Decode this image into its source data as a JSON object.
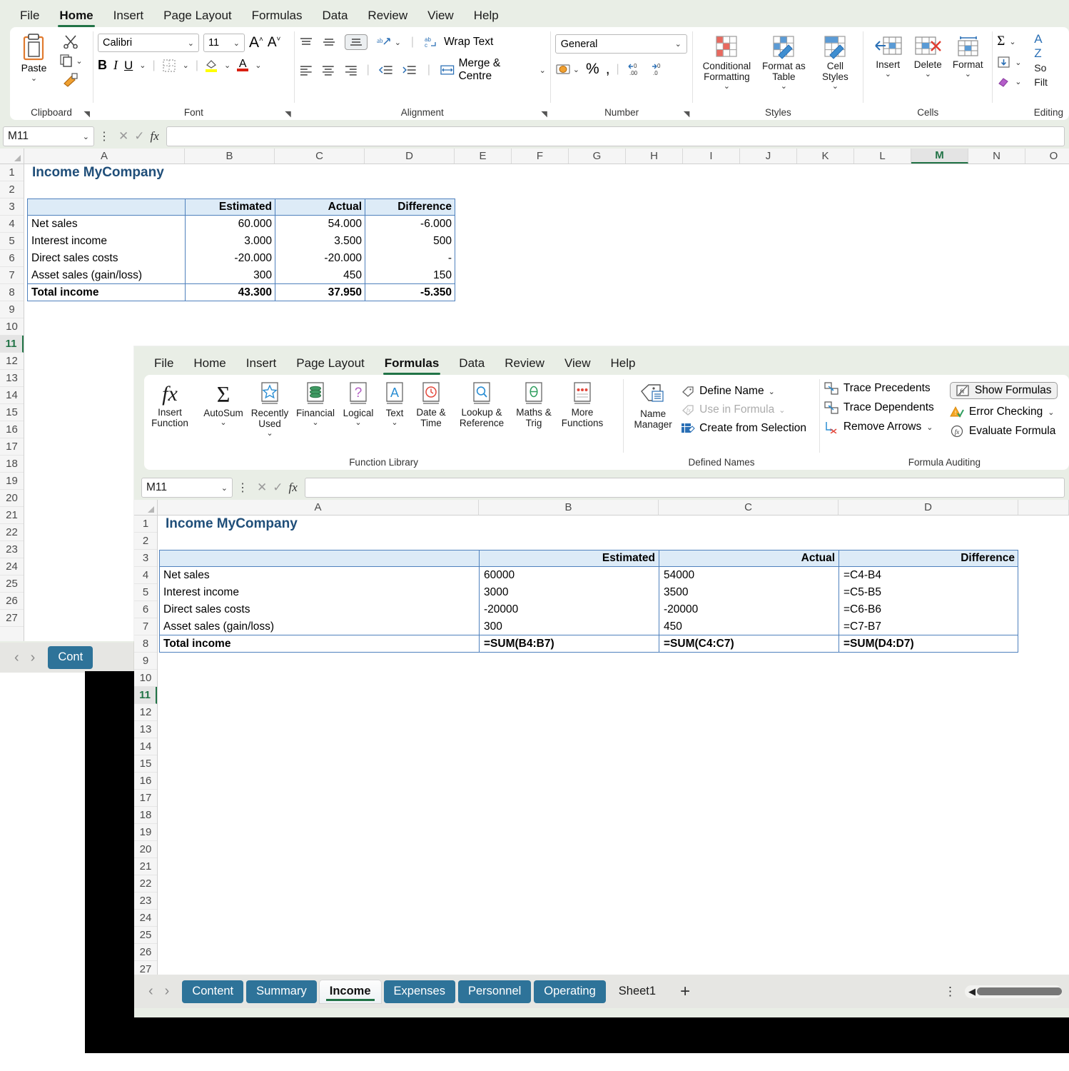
{
  "window1": {
    "ribbon_tabs": [
      "File",
      "Home",
      "Insert",
      "Page Layout",
      "Formulas",
      "Data",
      "Review",
      "View",
      "Help"
    ],
    "active_tab": "Home",
    "groups": {
      "clipboard": {
        "label": "Clipboard",
        "paste": "Paste",
        "icons": [
          "paste-icon",
          "cut-icon",
          "copy-icon",
          "format-painter-icon"
        ]
      },
      "font": {
        "label": "Font",
        "font_name": "Calibri",
        "font_size": "11",
        "buttons": [
          "B",
          "I",
          "U"
        ],
        "icons": [
          "grow-font-icon",
          "shrink-font-icon",
          "borders-icon",
          "fill-color-icon",
          "font-color-icon"
        ]
      },
      "alignment": {
        "label": "Alignment",
        "wrap_text": "Wrap Text",
        "merge_centre": "Merge & Centre"
      },
      "number": {
        "label": "Number",
        "format": "General",
        "icons": [
          "accounting-format-icon",
          "percent-icon",
          "comma-icon",
          "decrease-decimal-icon",
          "increase-decimal-icon"
        ]
      },
      "styles": {
        "label": "Styles",
        "conditional_formatting": "Conditional Formatting",
        "format_as_table": "Format as Table",
        "cell_styles": "Cell Styles"
      },
      "cells": {
        "label": "Cells",
        "insert": "Insert",
        "delete": "Delete",
        "format": "Format"
      },
      "editing": {
        "label": "Editing",
        "sort": "So",
        "filter": "Filt",
        "autosum_letter": "A",
        "sort_letter": "Z"
      }
    },
    "namebox": "M11",
    "formula_value": "",
    "columns": [
      "A",
      "B",
      "C",
      "D",
      "E",
      "F",
      "G",
      "H",
      "I",
      "J",
      "K",
      "L",
      "M",
      "N",
      "O"
    ],
    "selected_column": "M",
    "rows": [
      1,
      2,
      3,
      4,
      5,
      6,
      7,
      8,
      9,
      10,
      11,
      12,
      13,
      14,
      15,
      16,
      17,
      18,
      19,
      20,
      21,
      22,
      23,
      24,
      25,
      26,
      27
    ],
    "selected_row": 11,
    "sheet": {
      "title": "Income MyCompany",
      "headers": [
        "",
        "Estimated",
        "Actual",
        "Difference"
      ],
      "rows": [
        {
          "label": "Net sales",
          "estimated": "60.000",
          "actual": "54.000",
          "difference": "-6.000"
        },
        {
          "label": "Interest income",
          "estimated": "3.000",
          "actual": "3.500",
          "difference": "500"
        },
        {
          "label": "Direct sales costs",
          "estimated": "-20.000",
          "actual": "-20.000",
          "difference": "-"
        },
        {
          "label": "Asset sales (gain/loss)",
          "estimated": "300",
          "actual": "450",
          "difference": "150"
        }
      ],
      "total": {
        "label": "Total income",
        "estimated": "43.300",
        "actual": "37.950",
        "difference": "-5.350"
      }
    },
    "tabbar": {
      "first_tab": "Cont"
    }
  },
  "window2": {
    "ribbon_tabs": [
      "File",
      "Home",
      "Insert",
      "Page Layout",
      "Formulas",
      "Data",
      "Review",
      "View",
      "Help"
    ],
    "active_tab": "Formulas",
    "function_library": {
      "label": "Function Library",
      "items": [
        {
          "name": "Insert Function",
          "icon": "fx-icon"
        },
        {
          "name": "AutoSum",
          "icon": "sigma-icon"
        },
        {
          "name": "Recently Used",
          "icon": "star-book-icon"
        },
        {
          "name": "Financial",
          "icon": "coins-book-icon"
        },
        {
          "name": "Logical",
          "icon": "question-book-icon"
        },
        {
          "name": "Text",
          "icon": "letter-a-book-icon"
        },
        {
          "name": "Date & Time",
          "icon": "clock-book-icon"
        },
        {
          "name": "Lookup & Reference",
          "icon": "magnifier-book-icon"
        },
        {
          "name": "Maths & Trig",
          "icon": "theta-book-icon"
        },
        {
          "name": "More Functions",
          "icon": "ellipsis-book-icon"
        }
      ]
    },
    "defined_names": {
      "label": "Defined Names",
      "name_manager": "Name Manager",
      "define_name": "Define Name",
      "use_in_formula": "Use in Formula",
      "create_from_selection": "Create from Selection"
    },
    "formula_auditing": {
      "label": "Formula Auditing",
      "trace_precedents": "Trace Precedents",
      "trace_dependents": "Trace Dependents",
      "remove_arrows": "Remove Arrows",
      "show_formulas": "Show Formulas",
      "error_checking": "Error Checking",
      "evaluate_formula": "Evaluate Formula",
      "show_formulas_active": true
    },
    "namebox": "M11",
    "formula_value": "",
    "columns": [
      "A",
      "B",
      "C",
      "D"
    ],
    "rows": [
      1,
      2,
      3,
      4,
      5,
      6,
      7,
      8,
      9,
      10,
      11,
      12,
      13,
      14,
      15,
      16,
      17,
      18,
      19,
      20,
      21,
      22,
      23,
      24,
      25,
      26,
      27
    ],
    "selected_row": 11,
    "sheet": {
      "title": "Income MyCompany",
      "headers": [
        "",
        "Estimated",
        "Actual",
        "Difference"
      ],
      "rows": [
        {
          "label": "Net sales",
          "estimated": "60000",
          "actual": "54000",
          "difference": "=C4-B4"
        },
        {
          "label": "Interest income",
          "estimated": "3000",
          "actual": "3500",
          "difference": "=C5-B5"
        },
        {
          "label": "Direct sales costs",
          "estimated": "-20000",
          "actual": "-20000",
          "difference": "=C6-B6"
        },
        {
          "label": "Asset sales (gain/loss)",
          "estimated": "300",
          "actual": "450",
          "difference": "=C7-B7"
        }
      ],
      "total": {
        "label": "Total income",
        "estimated": "=SUM(B4:B7)",
        "actual": "=SUM(C4:C7)",
        "difference": "=SUM(D4:D7)"
      }
    },
    "sheet_tabs": [
      {
        "name": "Content",
        "active": false
      },
      {
        "name": "Summary",
        "active": false
      },
      {
        "name": "Income",
        "active": true
      },
      {
        "name": "Expenses",
        "active": false
      },
      {
        "name": "Personnel",
        "active": false
      },
      {
        "name": "Operating",
        "active": false
      },
      {
        "name": "Sheet1",
        "active": false,
        "plain": true
      }
    ],
    "add_sheet": "+"
  },
  "colors": {
    "accent_green": "#217346",
    "tab_blue": "#2e7399",
    "table_border": "#4f81bd",
    "header_fill": "#ddebf7",
    "title_text": "#1f4e79",
    "ribbon_bg": "#e9eee6"
  }
}
